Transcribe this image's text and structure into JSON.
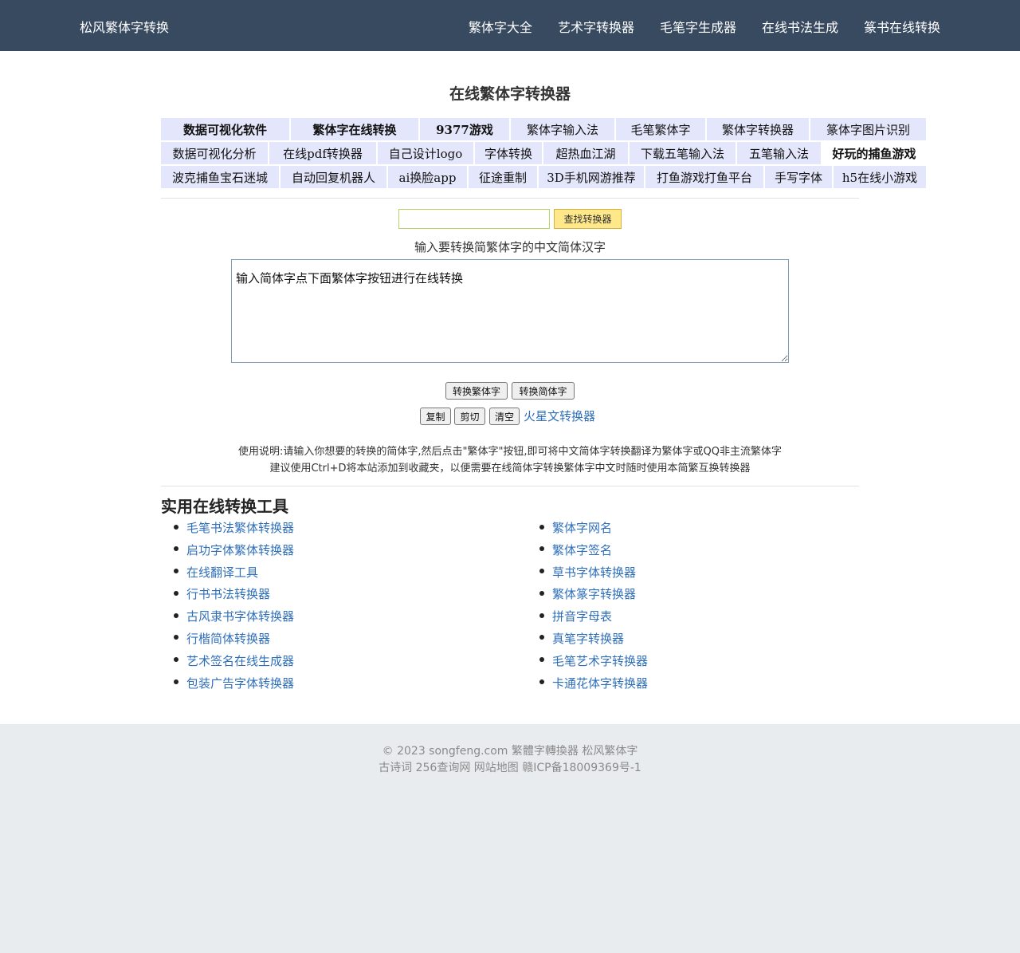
{
  "nav": {
    "brand": "松风繁体字转换",
    "links": [
      "繁体字大全",
      "艺术字转换器",
      "毛笔字生成器",
      "在线书法生成",
      "篆书在线转换"
    ]
  },
  "page_title": "在线繁体字转换器",
  "ad_rows": [
    [
      "数据可视化软件",
      "繁体字在线转换",
      "9377游戏",
      "繁体字输入法",
      "毛笔繁体字",
      "繁体字转换器",
      "篆体字图片识别"
    ],
    [
      "数据可视化分析",
      "在线pdf转换器",
      "自己设计logo",
      "字体转换",
      "超热血江湖",
      "下载五笔输入法",
      "五笔输入法",
      "好玩的捕鱼游戏"
    ],
    [
      "波克捕鱼宝石迷城",
      "自动回复机器人",
      "ai换脸app",
      "征途重制",
      "3D手机网游推荐",
      "打鱼游戏打鱼平台",
      "手写字体",
      "h5在线小游戏"
    ]
  ],
  "search": {
    "input_value": "",
    "button_label": "查找转换器"
  },
  "converter": {
    "label": "输入要转换简繁体字的中文简体汉字",
    "textarea_value": "输入简体字点下面繁体字按钮进行在线转换",
    "to_traditional_label": "转换繁体字",
    "to_simplified_label": "转换简体字",
    "copy_label": "复制",
    "cut_label": "剪切",
    "clear_label": "清空",
    "mars_link": "火星文转换器"
  },
  "help": {
    "line1": "使用说明:请输入你想要的转换的简体字,然后点击\"繁体字\"按钮,即可将中文简体字转换翻译为繁体字或QQ非主流繁体字",
    "line2": "建议使用Ctrl+D将本站添加到收藏夹，以便需要在线简体字转换繁体字中文时随时使用本简繁互换转换器"
  },
  "tools": {
    "title": "实用在线转换工具",
    "col1": [
      "毛笔书法繁体转换器",
      "启功字体繁体转换器",
      "在线翻译工具",
      "行书书法转换器",
      "古风隶书字体转换器",
      "行楷简体转换器",
      "艺术签名在线生成器",
      "包装广告字体转换器"
    ],
    "col2": [
      "繁体字网名",
      "繁体字签名",
      "草书字体转换器",
      "繁体篆字转换器",
      "拼音字母表",
      "真笔字转换器",
      "毛笔艺术字转换器",
      "卡通花体字转换器"
    ]
  },
  "footer": {
    "line1": "© 2023 songfeng.com 繁體字轉換器 松风繁体字",
    "line2": "古诗词 256查询网 网站地图 赣ICP备18009369号-1"
  },
  "colors": {
    "nav_bg": "#384a60",
    "ad_bg": "#e4e6fb",
    "link": "#2f6fba",
    "footer_bg": "#e9ecef",
    "search_btn_bg": "#ffe88a"
  }
}
